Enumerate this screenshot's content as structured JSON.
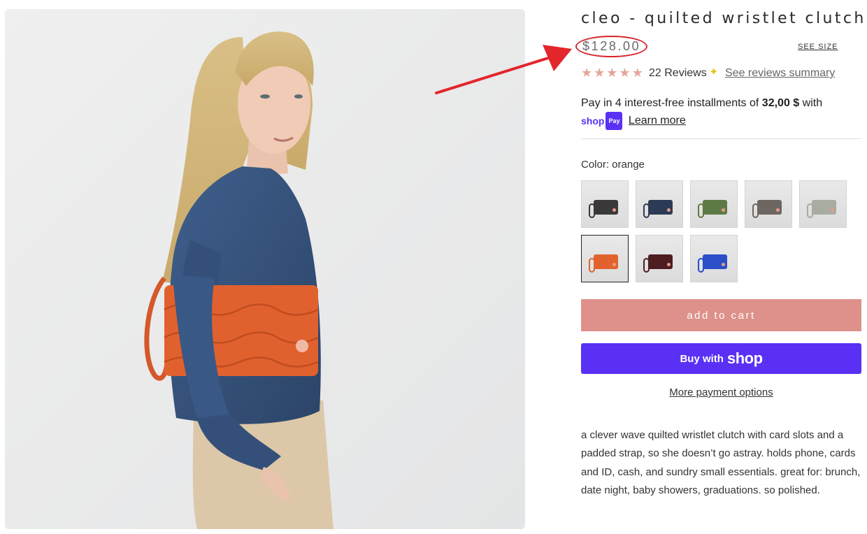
{
  "product": {
    "title": "cleo - quilted wristlet clutch",
    "price": "$128.00",
    "see_size": "SEE SIZE",
    "rating": 5,
    "reviews_label": "22 Reviews",
    "reviews_summary_link": "See reviews summary",
    "installments": {
      "prefix": "Pay in 4 interest-free installments of",
      "amount": "32,00 $",
      "suffix": "with",
      "shop_brand": "shop",
      "shop_badge": "Pay",
      "learn_more": "Learn more"
    },
    "color_label": "Color: orange",
    "swatches": [
      {
        "color": "black",
        "hex": "#3a3838"
      },
      {
        "color": "navy",
        "hex": "#2d3a55"
      },
      {
        "color": "olive green",
        "hex": "#5f7b45"
      },
      {
        "color": "taupe",
        "hex": "#6e6661"
      },
      {
        "color": "sage grey",
        "hex": "#a8aca1"
      },
      {
        "color": "orange",
        "hex": "#e2622e",
        "selected": true
      },
      {
        "color": "burgundy",
        "hex": "#4e1d22"
      },
      {
        "color": "royal blue",
        "hex": "#2b4fc8"
      }
    ],
    "add_to_cart": "add to cart",
    "buy_with": "Buy with",
    "buy_brand": "shop",
    "more_payment": "More payment options",
    "description": "a clever wave quilted wristlet clutch with card slots and a padded strap, so she doesn’t go astray. holds phone, cards and ID, cash, and sundry small essentials. great for: brunch, date night, baby showers, graduations. so polished."
  },
  "colors": {
    "accent_button": "#de918a",
    "shop_purple": "#5a31f4",
    "annotation_red": "#e3262b",
    "star": "#e5a49a"
  },
  "icons": {
    "star": "star-icon",
    "sparkle": "sparkle-icon",
    "arrow": "annotation-arrow"
  }
}
